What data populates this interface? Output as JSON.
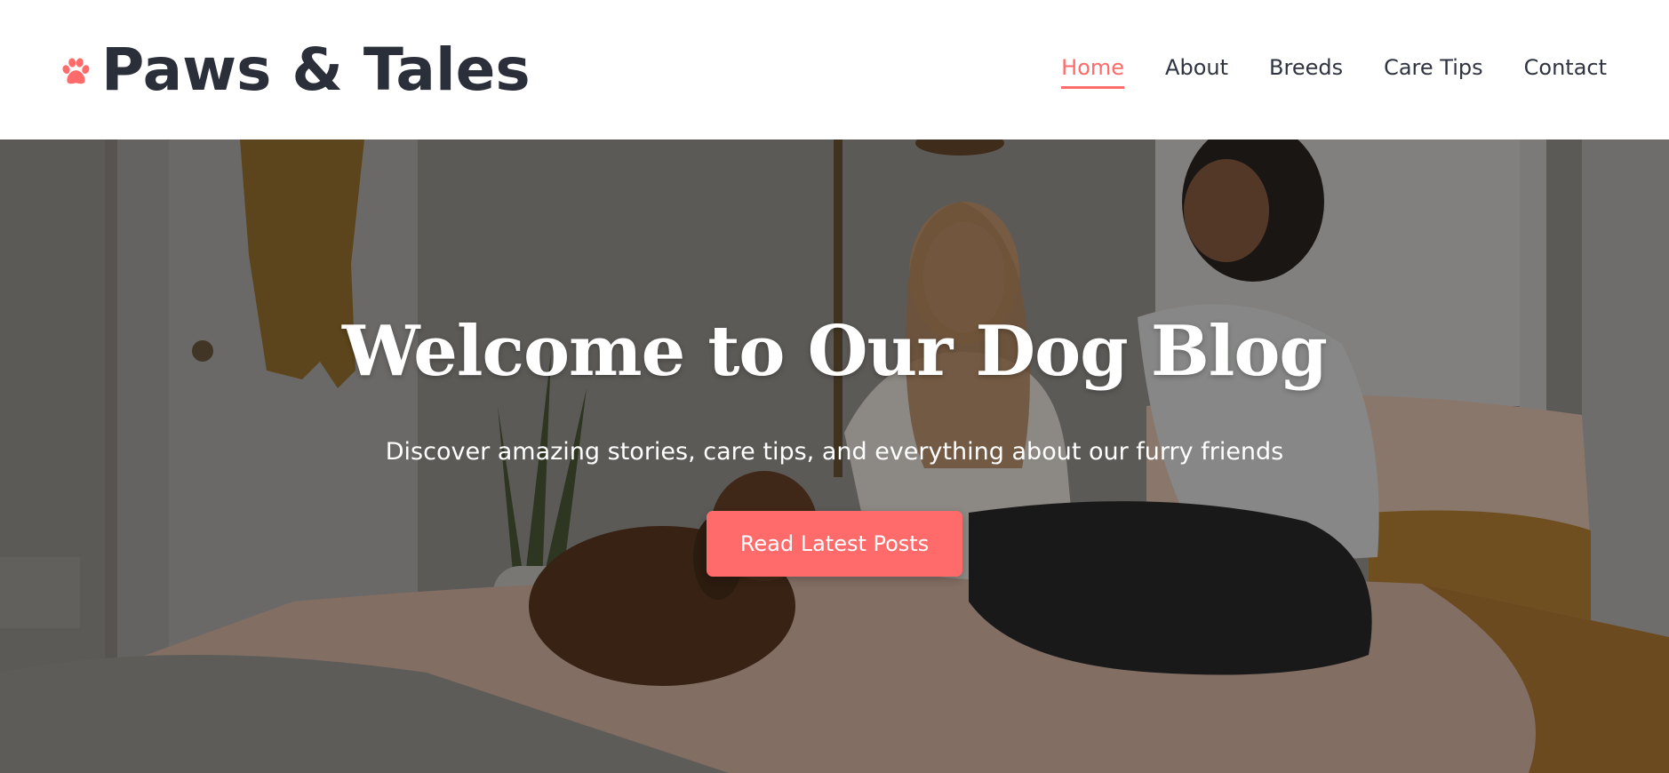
{
  "brand": {
    "title": "Paws & Tales",
    "icon": "paw-icon",
    "accent": "#ff6b6b"
  },
  "nav": {
    "items": [
      {
        "label": "Home",
        "active": true
      },
      {
        "label": "About",
        "active": false
      },
      {
        "label": "Breeds",
        "active": false
      },
      {
        "label": "Care Tips",
        "active": false
      },
      {
        "label": "Contact",
        "active": false
      }
    ]
  },
  "hero": {
    "title": "Welcome to Our Dog Blog",
    "subtitle": "Discover amazing stories, care tips, and everything about our furry friends",
    "cta_label": "Read Latest Posts",
    "cta_color": "#ff6b6b"
  }
}
